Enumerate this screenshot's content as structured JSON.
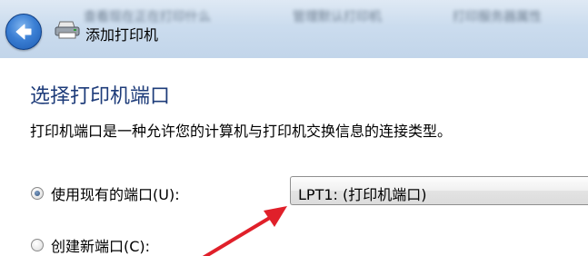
{
  "window": {
    "title": "添加打印机",
    "blurred_tabs": [
      "查看现在正在打印什么",
      "管理默认打印机",
      "打印服务器属性"
    ]
  },
  "icons": {
    "back": "back-arrow-icon",
    "printer": "printer-icon",
    "annotation": "red-arrow-icon"
  },
  "page": {
    "heading": "选择打印机端口",
    "description": "打印机端口是一种允许您的计算机与打印机交换信息的连接类型。"
  },
  "options": {
    "use_existing": {
      "label": "使用现有的端口(U):",
      "checked": true
    },
    "create_new": {
      "label": "创建新端口(C):",
      "checked": false
    }
  },
  "port_select": {
    "value": "LPT1: (打印机端口)"
  },
  "colors": {
    "heading": "#1e3c7a",
    "annotation_arrow": "#e0202a",
    "back_button": "#3b7fd4"
  }
}
